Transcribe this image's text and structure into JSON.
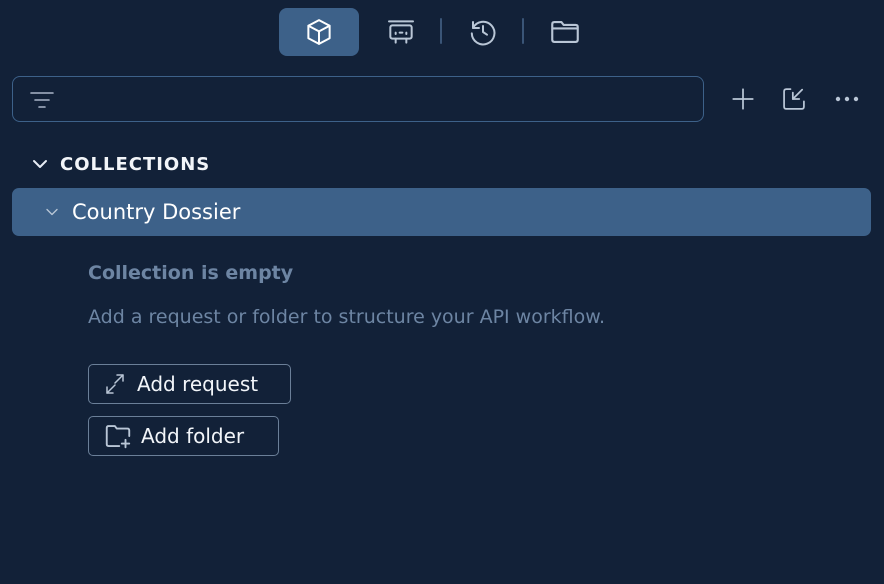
{
  "topbar": {
    "tabs": [
      {
        "icon": "cube-icon",
        "active": true
      },
      {
        "icon": "environment-icon",
        "active": false
      },
      {
        "icon": "history-icon",
        "active": false
      },
      {
        "icon": "folder-icon",
        "active": false
      }
    ]
  },
  "search": {
    "value": "",
    "placeholder": ""
  },
  "actions": [
    "plus-icon",
    "import-icon",
    "more-icon"
  ],
  "collections": {
    "header": "COLLECTIONS",
    "items": [
      {
        "name": "Country Dossier",
        "expanded": true
      }
    ]
  },
  "empty_state": {
    "title": "Collection is empty",
    "description": "Add a request or folder to structure your API workflow.",
    "add_request_label": "Add request",
    "add_folder_label": "Add folder"
  },
  "colors": {
    "background": "#122138",
    "accent": "#3d6189",
    "muted_text": "#6d85a3"
  }
}
